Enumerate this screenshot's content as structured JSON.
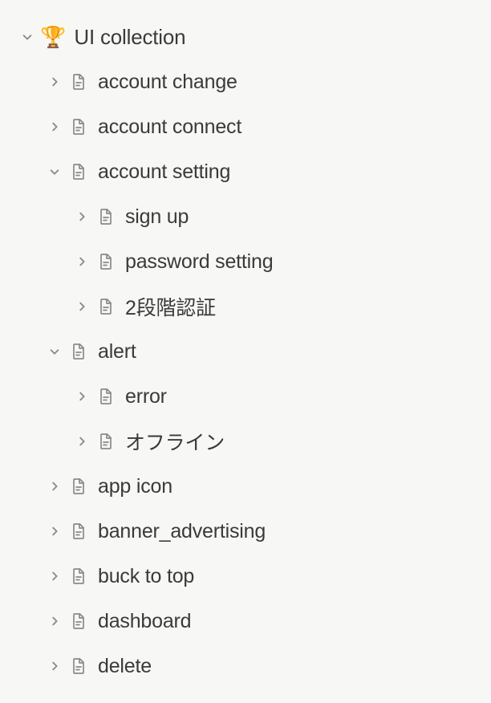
{
  "root": {
    "emoji": "🏆",
    "label": "UI collection",
    "expanded": true
  },
  "items": [
    {
      "label": "account change",
      "expanded": false,
      "depth": 1,
      "children": null
    },
    {
      "label": "account connect",
      "expanded": false,
      "depth": 1,
      "children": null
    },
    {
      "label": "account setting",
      "expanded": true,
      "depth": 1,
      "children": [
        {
          "label": "sign up",
          "expanded": false,
          "depth": 2
        },
        {
          "label": "password setting",
          "expanded": false,
          "depth": 2
        },
        {
          "label": "2段階認証",
          "expanded": false,
          "depth": 2
        }
      ]
    },
    {
      "label": "alert",
      "expanded": true,
      "depth": 1,
      "children": [
        {
          "label": "error",
          "expanded": false,
          "depth": 2
        },
        {
          "label": "オフライン",
          "expanded": false,
          "depth": 2
        }
      ]
    },
    {
      "label": "app icon",
      "expanded": false,
      "depth": 1,
      "children": null
    },
    {
      "label": "banner_advertising",
      "expanded": false,
      "depth": 1,
      "children": null
    },
    {
      "label": "buck to top",
      "expanded": false,
      "depth": 1,
      "children": null
    },
    {
      "label": "dashboard",
      "expanded": false,
      "depth": 1,
      "children": null
    },
    {
      "label": "delete",
      "expanded": false,
      "depth": 1,
      "children": null
    }
  ]
}
